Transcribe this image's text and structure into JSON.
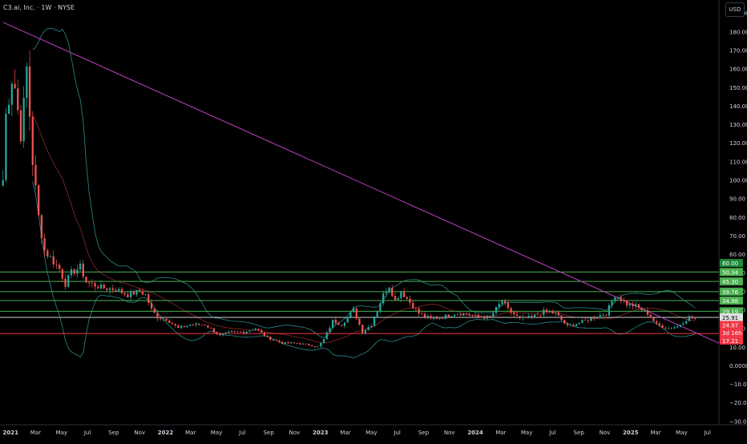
{
  "header": {
    "symbol_label": "C3.ai, Inc. · 1W · NYSE"
  },
  "currency_button": "USD",
  "colors": {
    "background": "#000000",
    "up": "#26a69a",
    "down": "#ef5350",
    "trendline": "#c040c0",
    "bollinger": "#2a8a8a",
    "ma": "#8b2a2a",
    "support_green": "#4caf50",
    "support_red": "#f23645",
    "axis_text": "#d1d4dc",
    "grid": "#131722"
  },
  "chart_data": {
    "type": "candlestick",
    "title": "",
    "xlabel": "",
    "ylabel": "",
    "ylim": [
      -30,
      200
    ],
    "y_ticks": [
      190,
      180,
      170,
      160,
      150,
      140,
      130,
      120,
      110,
      100,
      90,
      80,
      70,
      60,
      50,
      40,
      30,
      20,
      10,
      0,
      -10,
      -20,
      -30
    ],
    "y_tick_labels": [
      "190.00",
      "180.00",
      "170.00",
      "160.00",
      "150.00",
      "140.00",
      "130.00",
      "120.00",
      "110.00",
      "100.00",
      "90.00",
      "80.00",
      "70.00",
      "60.00",
      "50.00",
      "40.00",
      "30.00",
      "20.00",
      "10.00",
      "0.0000",
      "−10.00",
      "−20.00",
      "−30.00"
    ],
    "x_range": [
      "2020-12-07",
      "2025-07-28"
    ],
    "x_ticks": [
      {
        "date": "2021-01-01",
        "label": "2021",
        "bold": true
      },
      {
        "date": "2021-03-01",
        "label": "Mar"
      },
      {
        "date": "2021-05-01",
        "label": "May"
      },
      {
        "date": "2021-07-01",
        "label": "Jul"
      },
      {
        "date": "2021-09-01",
        "label": "Sep"
      },
      {
        "date": "2021-11-01",
        "label": "Nov"
      },
      {
        "date": "2022-01-01",
        "label": "2022",
        "bold": true
      },
      {
        "date": "2022-03-01",
        "label": "Mar"
      },
      {
        "date": "2022-05-01",
        "label": "May"
      },
      {
        "date": "2022-07-01",
        "label": "Jul"
      },
      {
        "date": "2022-09-01",
        "label": "Sep"
      },
      {
        "date": "2022-11-01",
        "label": "Nov"
      },
      {
        "date": "2023-01-01",
        "label": "2023",
        "bold": true
      },
      {
        "date": "2023-03-01",
        "label": "Mar"
      },
      {
        "date": "2023-05-01",
        "label": "May"
      },
      {
        "date": "2023-07-01",
        "label": "Jul"
      },
      {
        "date": "2023-09-01",
        "label": "Sep"
      },
      {
        "date": "2023-11-01",
        "label": "Nov"
      },
      {
        "date": "2024-01-01",
        "label": "2024",
        "bold": true
      },
      {
        "date": "2024-03-01",
        "label": "Mar"
      },
      {
        "date": "2024-05-01",
        "label": "May"
      },
      {
        "date": "2024-07-01",
        "label": "Jul"
      },
      {
        "date": "2024-09-01",
        "label": "Sep"
      },
      {
        "date": "2024-11-01",
        "label": "Nov"
      },
      {
        "date": "2025-01-01",
        "label": "2025",
        "bold": true
      },
      {
        "date": "2025-03-01",
        "label": "Mar"
      },
      {
        "date": "2025-05-01",
        "label": "May"
      },
      {
        "date": "2025-07-01",
        "label": "Jul"
      }
    ],
    "close_anchors": [
      [
        "2020-12-14",
        100
      ],
      [
        "2020-12-21",
        135
      ],
      [
        "2021-01-04",
        155
      ],
      [
        "2021-01-11",
        150
      ],
      [
        "2021-01-25",
        125
      ],
      [
        "2021-02-01",
        140
      ],
      [
        "2021-02-08",
        160
      ],
      [
        "2021-02-22",
        110
      ],
      [
        "2021-03-08",
        80
      ],
      [
        "2021-03-22",
        62
      ],
      [
        "2021-04-05",
        58
      ],
      [
        "2021-04-26",
        52
      ],
      [
        "2021-05-10",
        44
      ],
      [
        "2021-05-24",
        50
      ],
      [
        "2021-06-14",
        53
      ],
      [
        "2021-06-28",
        45
      ],
      [
        "2021-08-02",
        42
      ],
      [
        "2021-09-06",
        41
      ],
      [
        "2021-10-04",
        38
      ],
      [
        "2021-11-01",
        40
      ],
      [
        "2021-11-15",
        38
      ],
      [
        "2021-11-29",
        30
      ],
      [
        "2021-12-13",
        26
      ],
      [
        "2022-01-03",
        25
      ],
      [
        "2022-01-31",
        20
      ],
      [
        "2022-02-28",
        22
      ],
      [
        "2022-04-04",
        22
      ],
      [
        "2022-05-09",
        16
      ],
      [
        "2022-06-06",
        18
      ],
      [
        "2022-07-04",
        18
      ],
      [
        "2022-08-01",
        20
      ],
      [
        "2022-08-29",
        15
      ],
      [
        "2022-10-03",
        12
      ],
      [
        "2022-11-07",
        12
      ],
      [
        "2022-12-05",
        11
      ],
      [
        "2022-12-26",
        10
      ],
      [
        "2023-01-09",
        14
      ],
      [
        "2023-01-30",
        24
      ],
      [
        "2023-02-20",
        22
      ],
      [
        "2023-03-20",
        30
      ],
      [
        "2023-04-10",
        18
      ],
      [
        "2023-05-01",
        22
      ],
      [
        "2023-05-29",
        38
      ],
      [
        "2023-06-12",
        43
      ],
      [
        "2023-06-26",
        35
      ],
      [
        "2023-07-10",
        40
      ],
      [
        "2023-07-31",
        34
      ],
      [
        "2023-08-21",
        28
      ],
      [
        "2023-09-18",
        25
      ],
      [
        "2023-10-16",
        26
      ],
      [
        "2023-11-13",
        28
      ],
      [
        "2023-12-11",
        28
      ],
      [
        "2024-01-08",
        26
      ],
      [
        "2024-02-05",
        26
      ],
      [
        "2024-03-04",
        35
      ],
      [
        "2024-03-18",
        30
      ],
      [
        "2024-04-15",
        25
      ],
      [
        "2024-05-13",
        26
      ],
      [
        "2024-06-10",
        29
      ],
      [
        "2024-07-08",
        28
      ],
      [
        "2024-08-05",
        21
      ],
      [
        "2024-09-02",
        23
      ],
      [
        "2024-10-07",
        26
      ],
      [
        "2024-11-04",
        28
      ],
      [
        "2024-11-25",
        38
      ],
      [
        "2024-12-09",
        36
      ],
      [
        "2024-12-23",
        33
      ],
      [
        "2025-01-13",
        32
      ],
      [
        "2025-02-10",
        28
      ],
      [
        "2025-03-03",
        22
      ],
      [
        "2025-03-31",
        20
      ],
      [
        "2025-04-21",
        21
      ],
      [
        "2025-05-19",
        26
      ],
      [
        "2025-06-02",
        25
      ]
    ],
    "trendline": {
      "from": [
        "2020-12-14",
        185
      ],
      "to": [
        "2025-07-28",
        12
      ]
    },
    "levels": [
      {
        "price": 50.34,
        "color": "green"
      },
      {
        "price": 45.3,
        "color": "green"
      },
      {
        "price": 39.76,
        "color": "green"
      },
      {
        "price": 34.98,
        "color": "green"
      },
      {
        "price": 29.19,
        "color": "green"
      },
      {
        "price": 25.91,
        "color": "white"
      },
      {
        "price": 17.21,
        "color": "red"
      }
    ],
    "price_labels": [
      {
        "price": 55.2,
        "text": "60.00",
        "bg": "#1e8a3a"
      },
      {
        "price": 50.34,
        "text": "50.34",
        "bg": "#4caf50"
      },
      {
        "price": 45.3,
        "text": "45.30",
        "bg": "#4caf50"
      },
      {
        "price": 39.76,
        "text": "39.76",
        "bg": "#4caf50"
      },
      {
        "price": 34.98,
        "text": "34.98",
        "bg": "#4caf50"
      },
      {
        "price": 29.19,
        "text": "29.19",
        "bg": "#4caf50"
      },
      {
        "price": 25.91,
        "text": "25.91",
        "bg": "#e0e0e0",
        "fg": "#000"
      },
      {
        "price": 21.8,
        "text": "24.97",
        "bg": "#f23645"
      },
      {
        "price": 17.6,
        "text": "3d 16h",
        "bg": "#f23645"
      },
      {
        "price": 13.4,
        "text": "17.21",
        "bg": "#f23645"
      }
    ]
  }
}
